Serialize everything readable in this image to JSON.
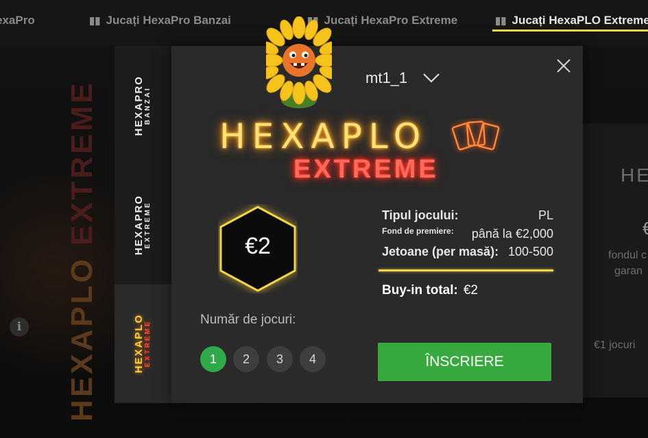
{
  "tabs": [
    {
      "label": "exaPro",
      "active": false
    },
    {
      "label": "Jucați HexaPro Banzai",
      "active": false
    },
    {
      "label": "Jucați HexaPro Extreme",
      "active": false
    },
    {
      "label": "Jucați HexaPLO Extreme",
      "active": true
    }
  ],
  "background": {
    "logo_text": "HEXAPLO",
    "logo_sub": "EXTREME",
    "right_texts": [
      "HE",
      "€",
      "fondul c",
      "garan",
      "€1 jocuri"
    ]
  },
  "side_tabs": [
    {
      "title": "HEXAPRO",
      "sub": "BANZAI",
      "active": false
    },
    {
      "title": "HEXAPRO",
      "sub": "EXTREME",
      "active": false
    },
    {
      "title": "HEXAPLO",
      "sub": "EXTREME",
      "active": true
    }
  ],
  "dialog": {
    "username": "mt1_1",
    "logo_title": "HEXAPLO",
    "logo_sub": "EXTREME",
    "buyin_badge": "€2",
    "game_type_label": "Tipul jocului:",
    "game_type_value": "PL",
    "prize_fund_label": "Fond de premiere:",
    "prize_fund_value": "până la €2,000",
    "chips_label": "Jetoane (per masă):",
    "chips_value": "100-500",
    "buyin_total_label": "Buy-in total:",
    "buyin_total_value": "€2",
    "games_label": "Număr de jocuri:",
    "game_counts": [
      "1",
      "2",
      "3",
      "4"
    ],
    "selected_count": "1",
    "register_label": "ÎNSCRIERE"
  },
  "colors": {
    "accent_gold": "#f2d44a",
    "register_green": "#37a93f",
    "selected_green": "#2fa94a",
    "dialog_bg": "#2a2a2a"
  }
}
